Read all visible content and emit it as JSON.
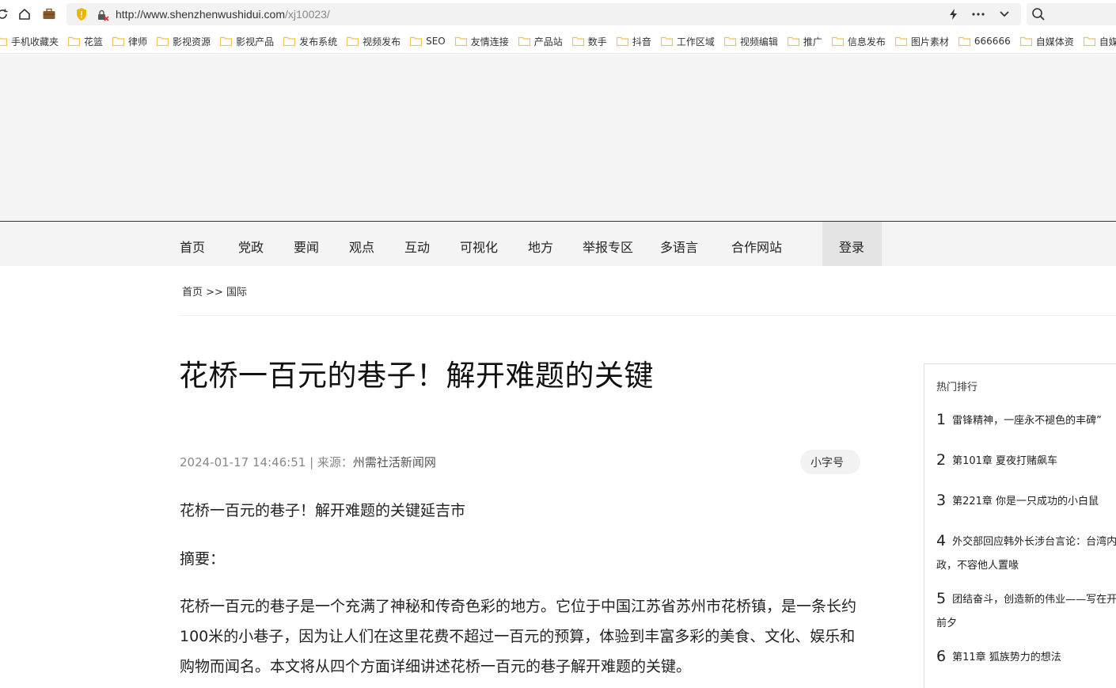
{
  "browser": {
    "url_host": "http://www.shenzhenwushidui.com",
    "url_path": "/xj10023/",
    "bookmarks": [
      "手机收藏夹",
      "花篮",
      "律师",
      "影视资源",
      "影视产品",
      "发布系统",
      "视频发布",
      "SEO",
      "友情连接",
      "产品站",
      "数手",
      "抖音",
      "工作区域",
      "视频编辑",
      "推广",
      "信息发布",
      "图片素材",
      "666666",
      "自媒体资",
      "自媒体"
    ]
  },
  "nav": {
    "items": [
      "首页",
      "党政",
      "要闻",
      "观点",
      "互动",
      "可视化",
      "地方",
      "举报专区",
      "多语言",
      "合作网站"
    ],
    "login": "登录"
  },
  "breadcrumb": "首页 >> 国际",
  "article": {
    "title": "花桥一百元的巷子！解开难题的关键",
    "datetime": "2024-01-17 14:46:51",
    "source_label": " | 来源：",
    "source": "州需社活新闻网",
    "font_size_button": "小字号",
    "lead": "花桥一百元的巷子！解开难题的关键延吉市",
    "abstract_label": "摘要：",
    "body": "花桥一百元的巷子是一个充满了神秘和传奇色彩的地方。它位于中国江苏省苏州市花桥镇，是一条长约100米的小巷子，因为让人们在这里花费不超过一百元的预算，体验到丰富多彩的美食、文化、娱乐和购物而闻名。本文将从四个方面详细讲述花桥一百元的巷子解开难题的关键。"
  },
  "sidebar": {
    "title": "热门排行",
    "items": [
      {
        "num": "1",
        "text": "雷锋精神，一座永不褪色的丰碑”"
      },
      {
        "num": "2",
        "text": "第101章 夏夜打赌飙车"
      },
      {
        "num": "3",
        "text": "第221章 你是一只成功的小白鼠"
      },
      {
        "num": "4",
        "text": "外交部回应韩外长涉台言论：台湾内政，不容他人置喙"
      },
      {
        "num": "5",
        "text": "团结奋斗，创造新的伟业——写在开前夕"
      },
      {
        "num": "6",
        "text": "第11章 狐族势力的想法"
      }
    ]
  },
  "colors": {
    "folder": "#f2c14e",
    "shield": "#f0b400"
  }
}
